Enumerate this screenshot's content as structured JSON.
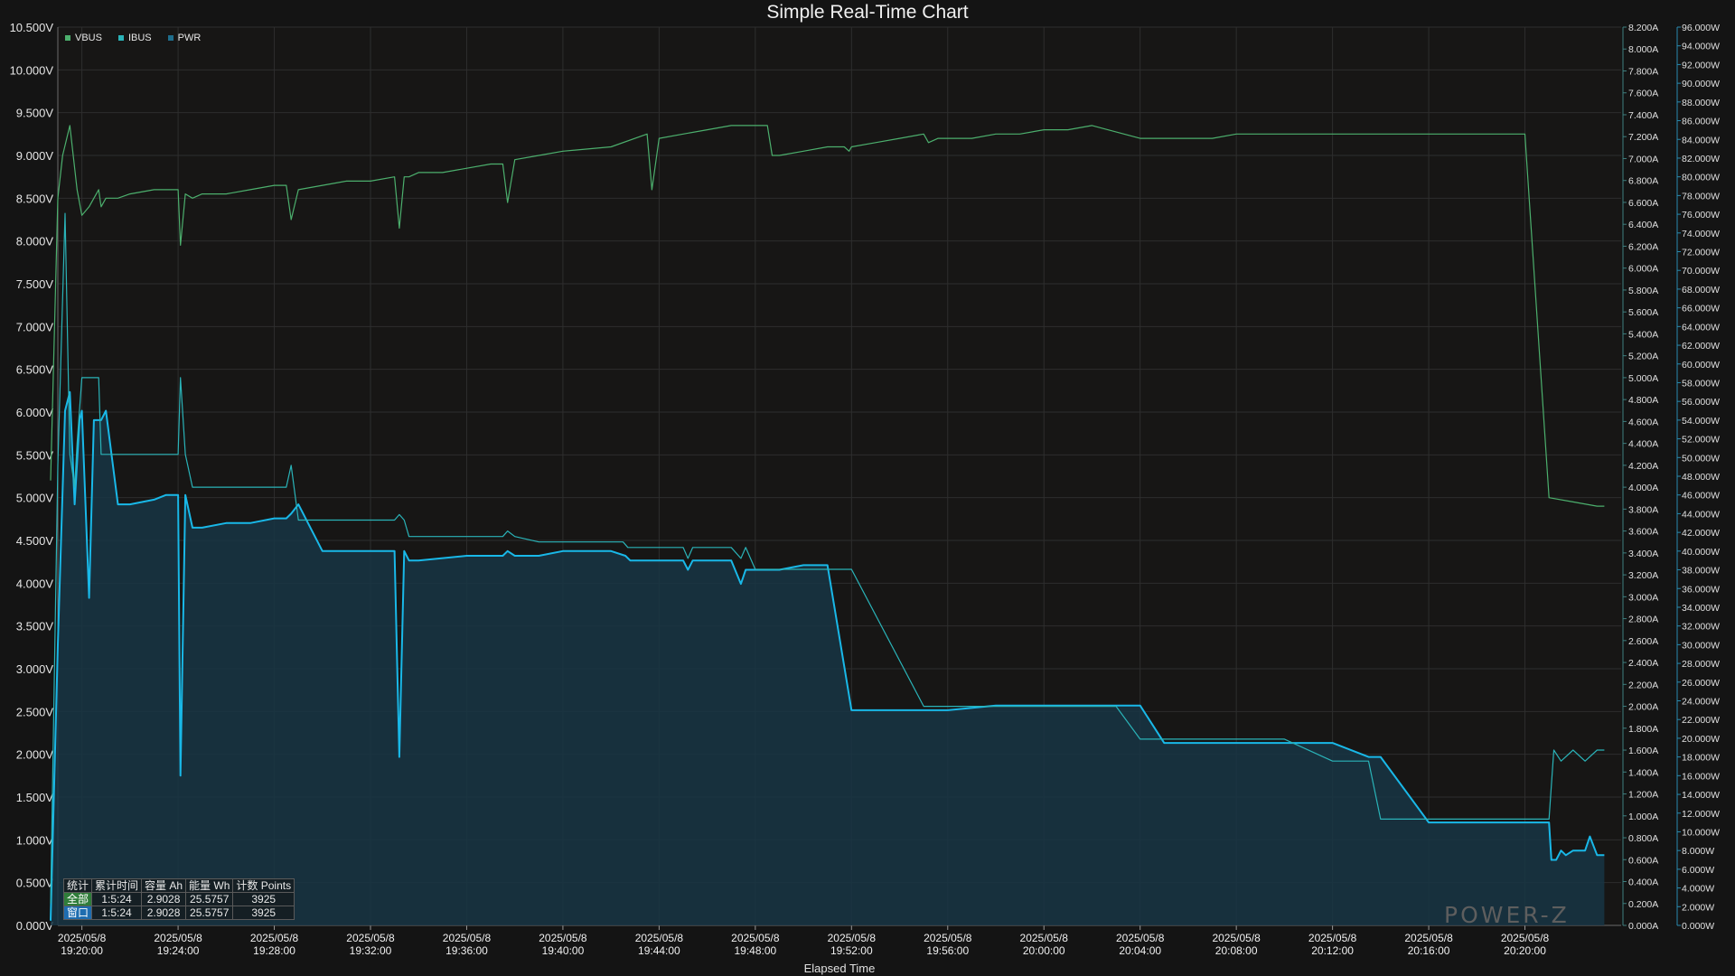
{
  "title": "Simple Real-Time Chart",
  "xlabel": "Elapsed Time",
  "watermark": "POWER-Z",
  "colors": {
    "vbus": "#4caf6d",
    "ibus": "#2ab3b8",
    "pwr": "#19b8e8",
    "grid": "#2e2e2e",
    "bg": "#141414"
  },
  "legend": [
    {
      "name": "VBUS",
      "color": "#4caf6d"
    },
    {
      "name": "IBUS",
      "color": "#2ab3b8"
    },
    {
      "name": "PWR",
      "color": "#1f6e8c"
    }
  ],
  "stats": {
    "headers": [
      "统计",
      "累计时间",
      "容量 Ah",
      "能量 Wh",
      "计数 Points"
    ],
    "rows": [
      [
        "全部",
        "1:5:24",
        "2.9028",
        "25.5757",
        "3925"
      ],
      [
        "窗口",
        "1:5:24",
        "2.9028",
        "25.5757",
        "3925"
      ]
    ]
  },
  "chart_data": {
    "type": "line",
    "x_unit": "minutes after 2025/05/8 19:20:00",
    "xlim": [
      -1,
      64
    ],
    "x_ticks": [
      [
        "2025/05/8",
        "19:20:00"
      ],
      [
        "2025/05/8",
        "19:24:00"
      ],
      [
        "2025/05/8",
        "19:28:00"
      ],
      [
        "2025/05/8",
        "19:32:00"
      ],
      [
        "2025/05/8",
        "19:36:00"
      ],
      [
        "2025/05/8",
        "19:40:00"
      ],
      [
        "2025/05/8",
        "19:44:00"
      ],
      [
        "2025/05/8",
        "19:48:00"
      ],
      [
        "2025/05/8",
        "19:52:00"
      ],
      [
        "2025/05/8",
        "19:56:00"
      ],
      [
        "2025/05/8",
        "20:00:00"
      ],
      [
        "2025/05/8",
        "20:04:00"
      ],
      [
        "2025/05/8",
        "20:08:00"
      ],
      [
        "2025/05/8",
        "20:12:00"
      ],
      [
        "2025/05/8",
        "20:16:00"
      ],
      [
        "2025/05/8",
        "20:20:00"
      ]
    ],
    "y_left": {
      "label": "V",
      "lim": [
        0,
        10.5
      ],
      "ticks": [
        "0.000V",
        "0.500V",
        "1.000V",
        "1.500V",
        "2.000V",
        "2.500V",
        "3.000V",
        "3.500V",
        "4.000V",
        "4.500V",
        "5.000V",
        "5.500V",
        "6.000V",
        "6.500V",
        "7.000V",
        "7.500V",
        "8.000V",
        "8.500V",
        "9.000V",
        "9.500V",
        "10.000V",
        "10.500V"
      ]
    },
    "y_right1": {
      "label": "A",
      "lim": [
        0,
        8.2
      ],
      "ticks": [
        "0.000A",
        "0.200A",
        "0.400A",
        "0.600A",
        "0.800A",
        "1.000A",
        "1.200A",
        "1.400A",
        "1.600A",
        "1.800A",
        "2.000A",
        "2.200A",
        "2.400A",
        "2.600A",
        "2.800A",
        "3.000A",
        "3.200A",
        "3.400A",
        "3.600A",
        "3.800A",
        "4.000A",
        "4.200A",
        "4.400A",
        "4.600A",
        "4.800A",
        "5.000A",
        "5.200A",
        "5.400A",
        "5.600A",
        "5.800A",
        "6.000A",
        "6.200A",
        "6.400A",
        "6.600A",
        "6.800A",
        "7.000A",
        "7.200A",
        "7.400A",
        "7.600A",
        "7.800A",
        "8.000A",
        "8.200A"
      ]
    },
    "y_right2": {
      "label": "W",
      "lim": [
        0,
        96
      ],
      "ticks": [
        "0.000W",
        "2.000W",
        "4.000W",
        "6.000W",
        "8.000W",
        "10.000W",
        "12.000W",
        "14.000W",
        "16.000W",
        "18.000W",
        "20.000W",
        "22.000W",
        "24.000W",
        "26.000W",
        "28.000W",
        "30.000W",
        "32.000W",
        "34.000W",
        "36.000W",
        "38.000W",
        "40.000W",
        "42.000W",
        "44.000W",
        "46.000W",
        "48.000W",
        "50.000W",
        "52.000W",
        "54.000W",
        "56.000W",
        "58.000W",
        "60.000W",
        "62.000W",
        "64.000W",
        "66.000W",
        "68.000W",
        "70.000W",
        "72.000W",
        "74.000W",
        "76.000W",
        "78.000W",
        "80.000W",
        "82.000W",
        "84.000W",
        "86.000W",
        "88.000W",
        "90.000W",
        "92.000W",
        "94.000W",
        "96.000W"
      ]
    },
    "series": [
      {
        "name": "VBUS",
        "axis": "left",
        "x": [
          -1.3,
          -1.0,
          -0.8,
          -0.5,
          -0.2,
          0.0,
          0.3,
          0.5,
          0.7,
          0.8,
          1.0,
          1.2,
          1.5,
          2.0,
          3.0,
          4.0,
          4.1,
          4.3,
          4.6,
          5.0,
          6.0,
          7.0,
          8.0,
          8.5,
          8.7,
          9.0,
          10.0,
          11.0,
          12.0,
          13.0,
          13.2,
          13.4,
          13.6,
          14.0,
          15.0,
          16.0,
          17.0,
          17.5,
          17.7,
          18.0,
          19.0,
          20.0,
          22.0,
          23.5,
          23.7,
          24.0,
          25.0,
          26.0,
          27.0,
          28.5,
          28.7,
          29.0,
          30.0,
          31.0,
          31.7,
          31.9,
          32.0,
          33.0,
          34.0,
          35.0,
          35.2,
          35.6,
          36.0,
          37.0,
          38.0,
          39.0,
          40.0,
          41.0,
          42.0,
          44.0,
          45.0,
          46.0,
          47.0,
          48.0,
          50.0,
          51.0,
          52.0,
          54.0,
          55.0,
          56.0,
          58.0,
          59.0,
          60.0,
          61.0,
          62.0,
          63.0,
          63.3
        ],
        "y": [
          5.2,
          8.5,
          9.0,
          9.35,
          8.6,
          8.3,
          8.4,
          8.5,
          8.6,
          8.4,
          8.5,
          8.5,
          8.5,
          8.55,
          8.6,
          8.6,
          7.95,
          8.55,
          8.5,
          8.55,
          8.55,
          8.6,
          8.65,
          8.65,
          8.25,
          8.6,
          8.65,
          8.7,
          8.7,
          8.75,
          8.15,
          8.75,
          8.75,
          8.8,
          8.8,
          8.85,
          8.9,
          8.9,
          8.45,
          8.95,
          9.0,
          9.05,
          9.1,
          9.25,
          8.6,
          9.2,
          9.25,
          9.3,
          9.35,
          9.35,
          9.0,
          9.0,
          9.05,
          9.1,
          9.1,
          9.05,
          9.1,
          9.15,
          9.2,
          9.25,
          9.15,
          9.2,
          9.2,
          9.2,
          9.25,
          9.25,
          9.3,
          9.3,
          9.35,
          9.2,
          9.2,
          9.2,
          9.2,
          9.25,
          9.25,
          9.25,
          9.25,
          9.25,
          9.25,
          9.25,
          9.25,
          9.25,
          9.25,
          5.0,
          4.95,
          4.9,
          4.9
        ]
      },
      {
        "name": "IBUS",
        "axis": "right1",
        "x": [
          -1.3,
          -1.0,
          -0.7,
          -0.5,
          -0.3,
          -0.2,
          0.0,
          0.2,
          0.5,
          0.7,
          0.8,
          1.0,
          1.5,
          2.0,
          2.5,
          3.0,
          3.5,
          4.0,
          4.1,
          4.3,
          4.6,
          5.0,
          6.0,
          7.0,
          8.0,
          8.5,
          8.7,
          9.0,
          10.0,
          11.0,
          12.0,
          13.0,
          13.2,
          13.4,
          13.6,
          14.0,
          15.0,
          16.0,
          17.0,
          17.5,
          17.7,
          18.0,
          19.0,
          20.0,
          21.0,
          22.0,
          22.5,
          22.7,
          23.0,
          24.0,
          25.0,
          25.2,
          25.4,
          26.0,
          27.0,
          27.4,
          27.6,
          28.0,
          29.0,
          30.0,
          31.0,
          32.0,
          35.0,
          36.0,
          38.0,
          40.0,
          41.0,
          43.0,
          44.0,
          46.0,
          46.5,
          47.0,
          48.0,
          50.0,
          52.0,
          53.5,
          54.0,
          56.0,
          60.0,
          61.0,
          61.2,
          61.5,
          62.0,
          62.5,
          63.0,
          63.3
        ],
        "y": [
          0.2,
          4.2,
          6.5,
          4.3,
          4.0,
          4.4,
          5.0,
          5.0,
          5.0,
          5.0,
          4.3,
          4.3,
          4.3,
          4.3,
          4.3,
          4.3,
          4.3,
          4.3,
          5.0,
          4.3,
          4.0,
          4.0,
          4.0,
          4.0,
          4.0,
          4.0,
          4.2,
          3.7,
          3.7,
          3.7,
          3.7,
          3.7,
          3.75,
          3.7,
          3.55,
          3.55,
          3.55,
          3.55,
          3.55,
          3.55,
          3.6,
          3.55,
          3.5,
          3.5,
          3.5,
          3.5,
          3.5,
          3.45,
          3.45,
          3.45,
          3.45,
          3.35,
          3.45,
          3.45,
          3.45,
          3.35,
          3.45,
          3.25,
          3.25,
          3.25,
          3.25,
          3.25,
          2.0,
          2.0,
          2.0,
          2.0,
          2.0,
          2.0,
          1.7,
          1.7,
          1.7,
          1.7,
          1.7,
          1.7,
          1.5,
          1.5,
          0.97,
          0.97,
          0.97,
          0.97,
          1.6,
          1.5,
          1.6,
          1.5,
          1.6,
          1.6
        ]
      },
      {
        "name": "PWR",
        "axis": "right2",
        "x": [
          -1.3,
          -1.0,
          -0.7,
          -0.5,
          -0.3,
          -0.1,
          0.0,
          0.3,
          0.5,
          0.7,
          0.8,
          1.0,
          1.5,
          2.0,
          3.0,
          3.5,
          4.0,
          4.1,
          4.3,
          4.6,
          5.0,
          6.0,
          7.0,
          8.0,
          8.5,
          8.7,
          9.0,
          10.0,
          11.0,
          12.0,
          13.0,
          13.2,
          13.4,
          13.6,
          14.0,
          16.0,
          17.0,
          17.5,
          17.7,
          18.0,
          19.0,
          20.0,
          22.0,
          22.6,
          22.8,
          23.0,
          25.0,
          25.2,
          25.4,
          26.0,
          27.0,
          27.4,
          27.6,
          28.0,
          29.0,
          30.0,
          31.0,
          32.0,
          33.0,
          35.0,
          35.2,
          35.4,
          36.0,
          38.0,
          40.0,
          41.0,
          42.0,
          44.0,
          45.0,
          47.0,
          48.0,
          50.0,
          52.0,
          53.5,
          54.0,
          56.0,
          58.0,
          60.0,
          61.0,
          61.1,
          61.3,
          61.5,
          61.7,
          62.0,
          62.5,
          62.7,
          63.0,
          63.3
        ],
        "y": [
          0.5,
          30.0,
          55.0,
          57.0,
          45.0,
          54.0,
          55.0,
          35.0,
          54.0,
          54.0,
          54.0,
          55.0,
          45.0,
          45.0,
          45.5,
          46.0,
          46.0,
          16.0,
          46.0,
          42.5,
          42.5,
          43.0,
          43.0,
          43.5,
          43.5,
          44.0,
          45.0,
          40.0,
          40.0,
          40.0,
          40.0,
          18.0,
          40.0,
          39.0,
          39.0,
          39.5,
          39.5,
          39.5,
          40.0,
          39.5,
          39.5,
          40.0,
          40.0,
          39.5,
          39.0,
          39.0,
          39.0,
          38.0,
          39.0,
          39.0,
          39.0,
          36.5,
          38.0,
          38.0,
          38.0,
          38.5,
          38.5,
          23.0,
          23.0,
          23.0,
          23.0,
          23.0,
          23.0,
          23.5,
          23.5,
          23.5,
          23.5,
          23.5,
          19.5,
          19.5,
          19.5,
          19.5,
          19.5,
          18.0,
          18.0,
          11.0,
          11.0,
          11.0,
          11.0,
          7.0,
          7.0,
          8.0,
          7.5,
          8.0,
          8.0,
          9.5,
          7.5,
          7.5
        ]
      }
    ],
    "grid": true,
    "legend_position": "top-left"
  }
}
